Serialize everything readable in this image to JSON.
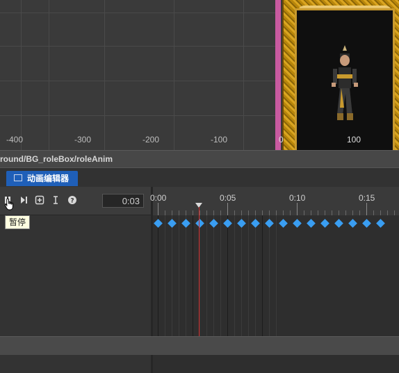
{
  "scene": {
    "ruler_labels": [
      "-400",
      "-300",
      "-200",
      "-100",
      "0",
      "100"
    ]
  },
  "path_bar": {
    "text": "round/BG_roleBox/roleAnim"
  },
  "tab": {
    "label": "动画编辑器"
  },
  "toolbar": {
    "buttons": [
      "pause-icon",
      "step-forward-icon",
      "add-keyframe-icon",
      "text-cursor-icon",
      "help-icon"
    ],
    "current_time": "0:03"
  },
  "tooltip": {
    "text": "暂停"
  },
  "timeline": {
    "labels": [
      "0:00",
      "0:05",
      "0:10",
      "0:15"
    ],
    "playhead_frame": 3,
    "keyframe_count": 17
  },
  "colors": {
    "tab_bg": "#1f5fb8",
    "keyframe": "#3a9ef2",
    "playhead": "#d02b2b"
  }
}
